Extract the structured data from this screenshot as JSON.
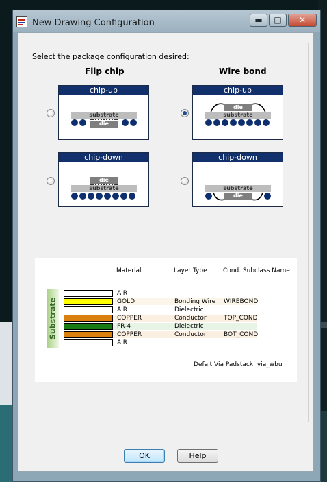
{
  "window": {
    "title": "New Drawing Configuration",
    "controls": {
      "minimize": "▬",
      "maximize": "□",
      "close": "✕"
    }
  },
  "prompt": "Select the package configuration desired:",
  "columns": {
    "flip_chip": "Flip chip",
    "wire_bond": "Wire bond"
  },
  "options": [
    {
      "title": "chip-up",
      "column": "flip_chip",
      "selected": false,
      "labels": {
        "substrate": "substrate",
        "die": "die"
      }
    },
    {
      "title": "chip-up",
      "column": "wire_bond",
      "selected": true,
      "labels": {
        "substrate": "substrate",
        "die": "die"
      }
    },
    {
      "title": "chip-down",
      "column": "flip_chip",
      "selected": false,
      "labels": {
        "substrate": "substrate",
        "die": "die"
      }
    },
    {
      "title": "chip-down",
      "column": "wire_bond",
      "selected": false,
      "labels": {
        "substrate": "substrate",
        "die": "die"
      }
    }
  ],
  "stackup": {
    "headers": {
      "material": "Material",
      "layer_type": "Layer Type",
      "subclass": "Cond. Subclass Name"
    },
    "side_label": "Substrate",
    "layers": [
      {
        "material": "AIR",
        "type": "",
        "subclass": "",
        "color": "#ffffff"
      },
      {
        "material": "GOLD",
        "type": "Bonding Wire",
        "subclass": "WIREBOND",
        "color": "#ffff00"
      },
      {
        "material": "AIR",
        "type": "Dielectric",
        "subclass": "",
        "color": "#ffffff"
      },
      {
        "material": "COPPER",
        "type": "Conductor",
        "subclass": "TOP_COND",
        "color": "#d9800f"
      },
      {
        "material": "FR-4",
        "type": "Dielectric",
        "subclass": "",
        "color": "#1a7a14"
      },
      {
        "material": "COPPER",
        "type": "Conductor",
        "subclass": "BOT_COND",
        "color": "#d9800f"
      },
      {
        "material": "AIR",
        "type": "",
        "subclass": "",
        "color": "#ffffff"
      }
    ],
    "default_padstack": "Defalt Via Padstack: via_wbu"
  },
  "buttons": {
    "ok": "OK",
    "help": "Help"
  },
  "colors": {
    "card_header": "#12306b",
    "ball": "#0e2f6f",
    "title_bar": "#9bb0bf"
  }
}
